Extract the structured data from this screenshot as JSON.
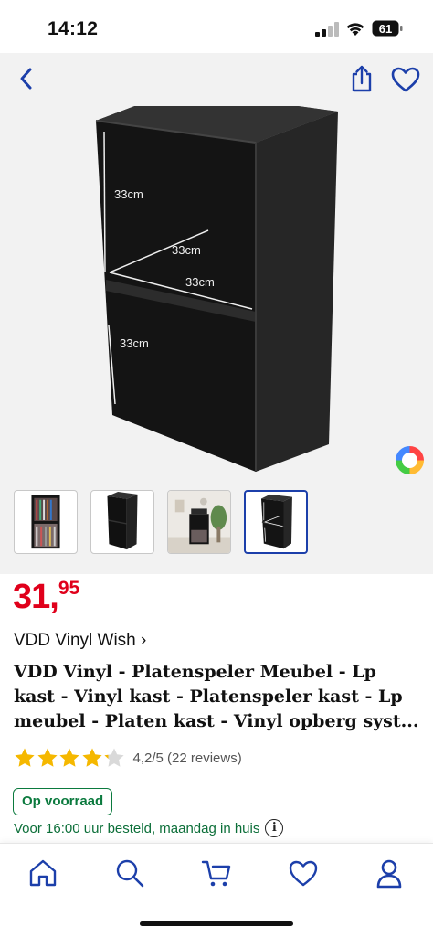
{
  "status_bar": {
    "time": "14:12",
    "battery": "61"
  },
  "product": {
    "price_main": "31,",
    "price_cents": "95",
    "brand": "VDD Vinyl Wish",
    "brand_chevron": "›",
    "title": "VDD Vinyl - Platenspeler Meubel - Lp kast - Vinyl kast - Platenspeler kast - Lp meubel - Platen kast - Vinyl opberg syst...",
    "rating": 4.2,
    "rating_text": "4,2/5 (22 reviews)",
    "stock_label": "Op voorraad",
    "delivery_text": "Voor 16:00 uur besteld, maandag in huis",
    "info_icon_glyph": "i",
    "dimension_labels": [
      "33cm",
      "33cm",
      "33cm",
      "33cm"
    ]
  },
  "gallery": {
    "thumbnail_count": 4,
    "active_index": 3
  },
  "icons": {
    "top": [
      "back-chevron-icon",
      "share-icon",
      "heart-icon"
    ],
    "tabbar": [
      "home-icon",
      "search-icon",
      "cart-icon",
      "heart-icon",
      "user-icon"
    ]
  },
  "colors": {
    "accent": "#1c3faa",
    "price": "#e0001b",
    "stock": "#0b7a3e",
    "star": "#f5b800",
    "image_bg": "#f2f2f2"
  }
}
